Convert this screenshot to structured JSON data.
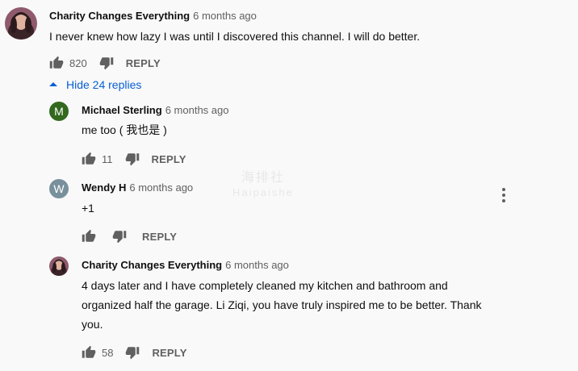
{
  "comment": {
    "author": "Charity Changes Everything",
    "time": "6 months ago",
    "text": "I never knew how lazy I was until I discovered this channel. I will do better.",
    "likes": "820",
    "reply_label": "REPLY",
    "toggle_label": "Hide 24 replies"
  },
  "replies": [
    {
      "avatar_letter": "M",
      "avatar_color": "#33691e",
      "author": "Michael Sterling",
      "time": "6 months ago",
      "text": "me too ( 我也是 )",
      "likes": "11",
      "reply_label": "REPLY"
    },
    {
      "avatar_letter": "W",
      "avatar_color": "#78909c",
      "author": "Wendy H",
      "time": "6 months ago",
      "text": "+1",
      "likes": "",
      "reply_label": "REPLY"
    },
    {
      "author": "Charity Changes Everything",
      "time": "6 months ago",
      "text_lines": [
        "4 days later and I have completely cleaned my kitchen and bathroom and",
        "organized half the garage. Li Ziqi, you have truly inspired me to be better. Thank",
        "you."
      ],
      "likes": "58",
      "reply_label": "REPLY"
    }
  ],
  "watermark": {
    "line1": "海排社",
    "line2": "Haipaishe"
  },
  "colors": {
    "link": "#065fd4",
    "secondary_text": "#606060"
  }
}
